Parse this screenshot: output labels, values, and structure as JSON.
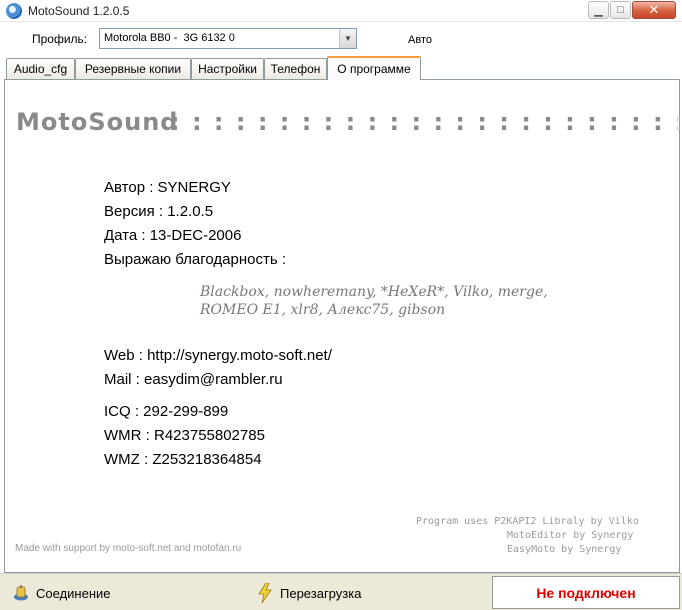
{
  "window": {
    "title": "MotoSound 1.2.0.5"
  },
  "profile": {
    "label": "Профиль:",
    "value": "Motorola BB0 -  3G 6132 0",
    "auto_label": "Авто"
  },
  "tabs": [
    {
      "label": "Audio_cfg"
    },
    {
      "label": "Резервные копии"
    },
    {
      "label": "Настройки"
    },
    {
      "label": "Телефон"
    },
    {
      "label": "О программе",
      "active": true
    }
  ],
  "about": {
    "heading": "MotoSound",
    "heading_dots": ": : : : : : : : : : : : : : : : : : : : : : : : : : : : : : : : : : : :",
    "author": "Автор : SYNERGY",
    "version": "Версия : 1.2.0.5",
    "date": "Дата : 13-DEC-2006",
    "thanks_label": "Выражаю благодарность :",
    "thanks_line1": "Blackbox, nowheremany, *HeXeR*, Vilko, merge,",
    "thanks_line2": "ROMEO E1, xlr8, Алекс75, gibson",
    "web": "Web : http://synergy.moto-soft.net/",
    "mail": "Mail  : easydim@rambler.ru",
    "icq": "ICQ  : 292-299-899",
    "wmr": "WMR : R423755802785",
    "wmz": "WMZ : Z253218364854",
    "credits_line1": "Program uses P2KAPI2 Libraly by Vilko",
    "credits_line2": "MotoEditor by Synergy",
    "credits_line3": "EasyMoto by Synergy",
    "support": "Made with support by moto-soft.net and motofan.ru"
  },
  "statusbar": {
    "connect_label": "Соединение",
    "reboot_label": "Перезагрузка",
    "state": "Не подключен",
    "state_color": "#e00000"
  },
  "colors": {
    "tab_active_accent": "#ff9c3b",
    "close_button": "#d6603f"
  }
}
